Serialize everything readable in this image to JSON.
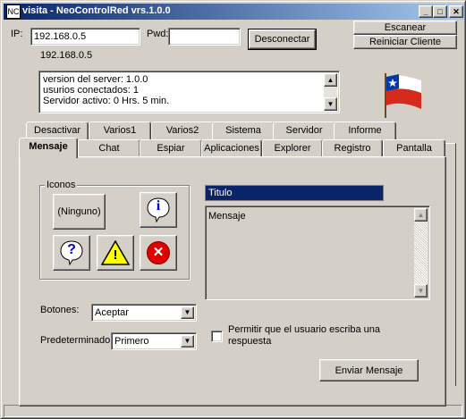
{
  "window": {
    "title": "visita - NeoControlRed vrs.1.0.0",
    "app_icon": "NC"
  },
  "titlebar_buttons": {
    "minimize": "_",
    "maximize": "□",
    "close": "✕"
  },
  "connection": {
    "ip_label": "IP:",
    "ip_value": "192.168.0.5",
    "pwd_label": "Pwd:",
    "pwd_value": "",
    "connect_button": "Desconectar",
    "ip_display": "192.168.0.5",
    "escanear_button": "Escanear",
    "reiniciar_button": "Reiniciar Cliente"
  },
  "server_info": {
    "line1": "version del server: 1.0.0",
    "line2": "usurios conectados: 1",
    "line3": "Servidor activo: 0 Hrs. 5 min."
  },
  "flag": {
    "icon": "chile-flag-icon"
  },
  "tabs_row1": [
    "Desactivar",
    "Varios1",
    "Varios2",
    "Sistema",
    "Servidor",
    "Informe"
  ],
  "tabs_row2": [
    "Mensaje",
    "Chat",
    "Espiar",
    "Aplicaciones",
    "Explorer",
    "Registro",
    "Pantalla"
  ],
  "active_tab": "Mensaje",
  "mensaje": {
    "iconos_label": "Iconos",
    "ninguno_button": "(Ninguno)",
    "info_glyph": "i",
    "question_glyph": "?",
    "warning_glyph": "!",
    "error_glyph": "✕",
    "titulo_value": "Titulo",
    "mensaje_value": "Mensaje",
    "botones_label": "Botones:",
    "botones_value": "Aceptar",
    "predeterminado_label": "Predeterminado:",
    "predeterminado_value": "Primero",
    "permitir_label_1": "Permitir que el usuario escriba una",
    "permitir_label_2": "respuesta",
    "enviar_button": "Enviar Mensaje"
  },
  "colors": {
    "titlebar_start": "#0a246a",
    "titlebar_end": "#a6caf0",
    "face": "#d4d0c8",
    "selection": "#0a246a"
  }
}
